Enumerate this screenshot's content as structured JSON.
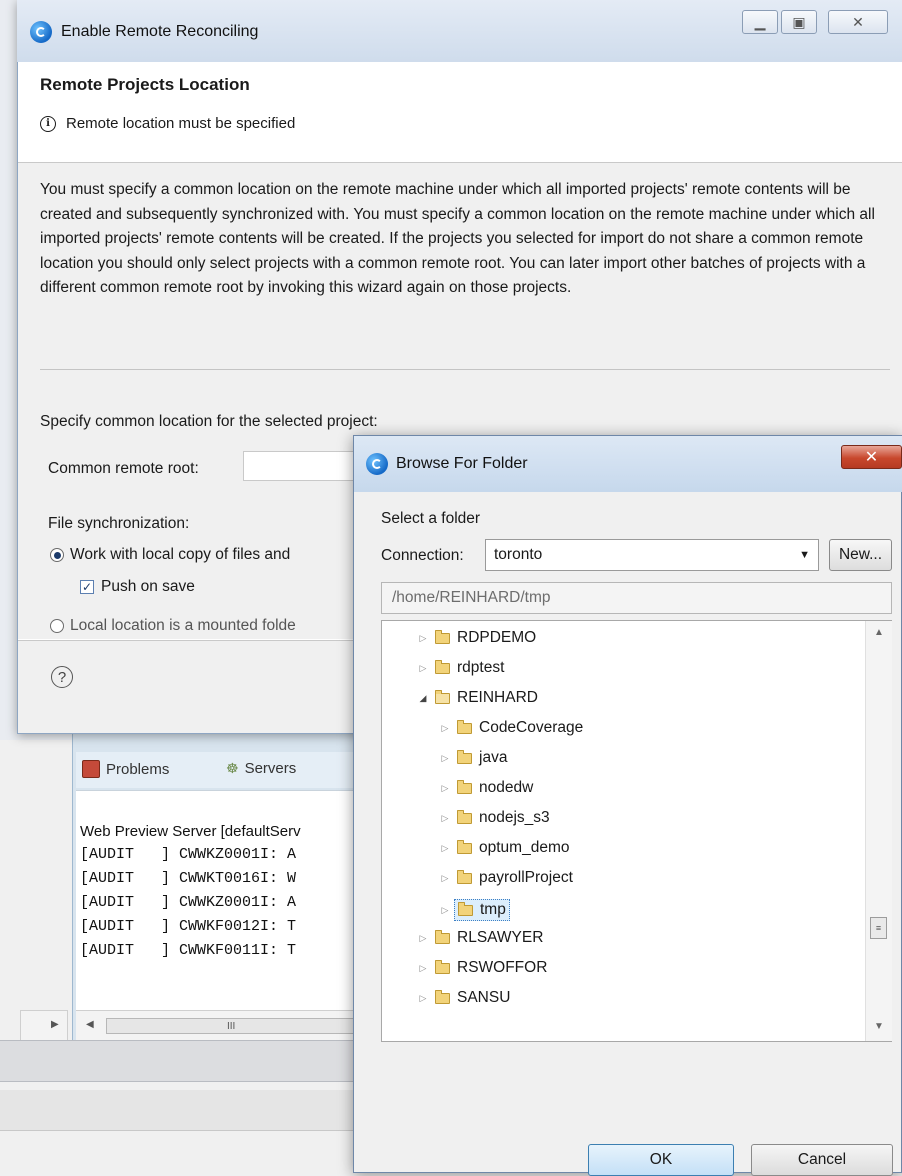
{
  "main_dialog": {
    "title": "Enable Remote Reconciling",
    "header_title": "Remote Projects Location",
    "header_message": "Remote location must be specified",
    "description": "You must specify a common location on the remote machine under which all imported projects' remote contents will be created and subsequently synchronized with.  You must specify a common location on the remote machine under which all imported projects' remote contents will be created.  If the projects you selected for import do not share a common remote location you should only select projects with a common remote root.  You can later import other batches of projects with a different common remote root by invoking this wizard again on those projects.",
    "specify_label": "Specify common location for the selected project:",
    "common_root_label": "Common remote root:",
    "common_root_value": "",
    "file_sync_label": "File synchronization:",
    "radio_work_local": "Work with local copy of files and",
    "push_on_save": "Push on save",
    "radio_local_mounted": "Local location is a mounted folde",
    "help_glyph": "?"
  },
  "background": {
    "tabs": [
      "Problems",
      "Servers"
    ],
    "console_title": "Web Preview Server [defaultServ",
    "console_lines": [
      "[AUDIT   ] CWWKZ0001I: A",
      "[AUDIT   ] CWWKT0016I: W",
      "[AUDIT   ] CWWKZ0001I: A",
      "[AUDIT   ] CWWKF0012I: T",
      "[AUDIT   ] CWWKF0011I: T"
    ]
  },
  "browse_dialog": {
    "title": "Browse For Folder",
    "select_label": "Select a folder",
    "connection_label": "Connection:",
    "connection_value": "toronto",
    "new_button": "New...",
    "path": "/home/REINHARD/tmp",
    "tree": [
      {
        "label": "RDPDEMO",
        "level": 0,
        "expanded": false
      },
      {
        "label": "rdptest",
        "level": 0,
        "expanded": false
      },
      {
        "label": "REINHARD",
        "level": 0,
        "expanded": true
      },
      {
        "label": "CodeCoverage",
        "level": 1,
        "expanded": false
      },
      {
        "label": "java",
        "level": 1,
        "expanded": false
      },
      {
        "label": "nodedw",
        "level": 1,
        "expanded": false
      },
      {
        "label": "nodejs_s3",
        "level": 1,
        "expanded": false
      },
      {
        "label": "optum_demo",
        "level": 1,
        "expanded": false
      },
      {
        "label": "payrollProject",
        "level": 1,
        "expanded": false
      },
      {
        "label": "tmp",
        "level": 1,
        "expanded": false,
        "selected": true
      },
      {
        "label": "RLSAWYER",
        "level": 0,
        "expanded": false
      },
      {
        "label": "RSWOFFOR",
        "level": 0,
        "expanded": false
      },
      {
        "label": "SANSU",
        "level": 0,
        "expanded": false
      }
    ],
    "ok_button": "OK",
    "cancel_button": "Cancel"
  }
}
